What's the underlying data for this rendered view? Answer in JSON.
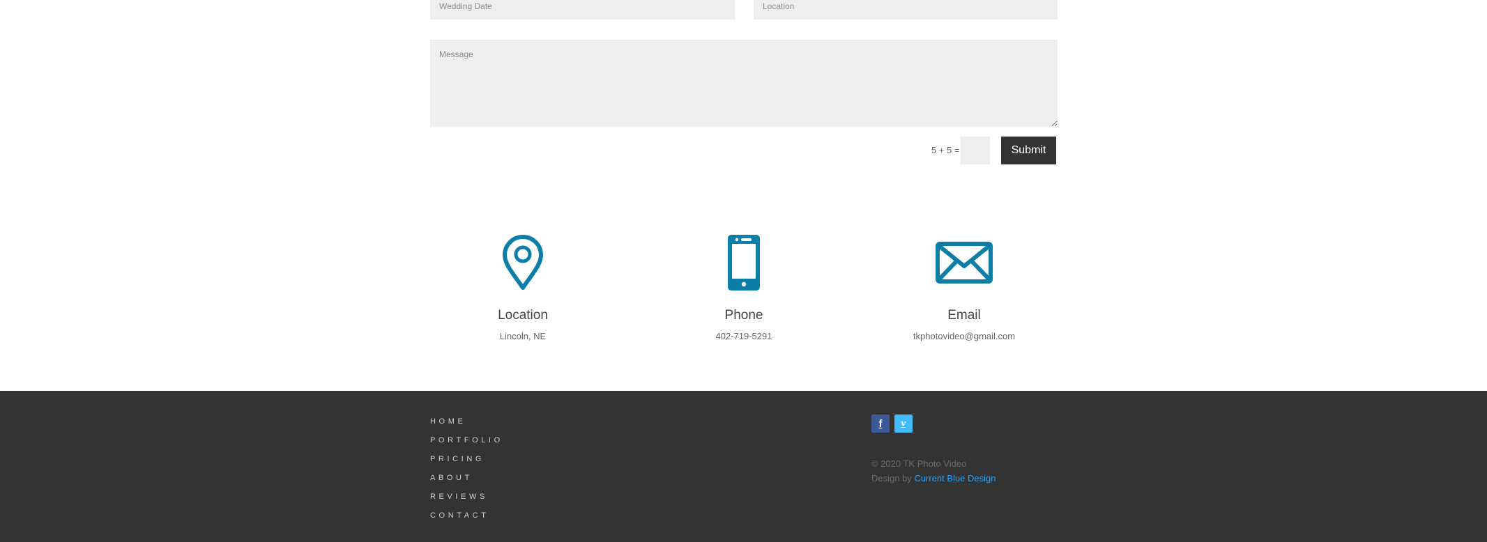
{
  "form": {
    "wedding_date_placeholder": "Wedding Date",
    "location_placeholder": "Location",
    "message_placeholder": "Message",
    "captcha_question": "5 + 5 =",
    "submit_label": "Submit"
  },
  "contact_info": [
    {
      "icon": "map-pin-icon",
      "title": "Location",
      "text": "Lincoln, NE"
    },
    {
      "icon": "phone-icon",
      "title": "Phone",
      "text": "402-719-5291"
    },
    {
      "icon": "envelope-icon",
      "title": "Email",
      "text": "tkphotovideo@gmail.com"
    }
  ],
  "footer": {
    "nav": [
      "HOME",
      "PORTFOLIO",
      "PRICING",
      "ABOUT",
      "REVIEWS",
      "CONTACT"
    ],
    "social": [
      {
        "icon": "facebook-icon",
        "glyph": "f",
        "color": "#3b5998"
      },
      {
        "icon": "vimeo-icon",
        "glyph": "v",
        "color": "#45bbff"
      }
    ],
    "copyright": "© 2020 TK Photo Video",
    "credit_prefix": "Design by",
    "credit_link": "Current Blue Design"
  },
  "colors": {
    "accent": "#0c7ea8",
    "footer_bg": "#333333",
    "field_bg": "#eeeeee",
    "link": "#2ea3f2"
  }
}
